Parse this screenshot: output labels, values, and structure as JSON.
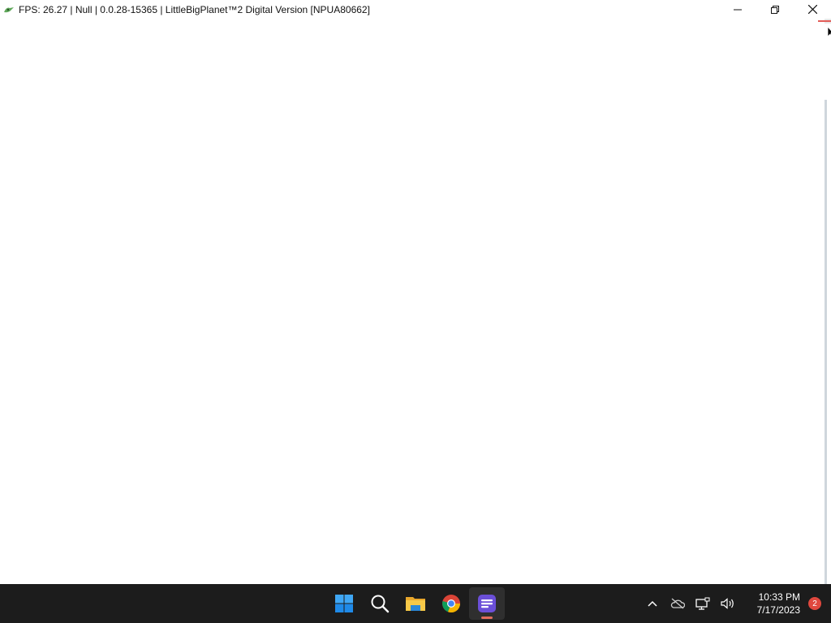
{
  "window": {
    "title": "FPS: 26.27 | Null | 0.0.28-15365 | LittleBigPlanet™2 Digital Version [NPUA80662]",
    "icon": "rpcs3-app-icon",
    "controls": [
      "minimize-icon",
      "restore-icon",
      "close-icon"
    ]
  },
  "taskbar": {
    "pinned": [
      {
        "name": "start",
        "icon": "windows-start-icon"
      },
      {
        "name": "search",
        "icon": "search-icon"
      },
      {
        "name": "file-explorer",
        "icon": "folder-icon"
      },
      {
        "name": "chrome",
        "icon": "chrome-icon"
      },
      {
        "name": "app",
        "icon": "purple-app-icon",
        "active": true
      }
    ],
    "tray": {
      "icons": [
        "chevron-up-icon",
        "onedrive-offline-icon",
        "network-icon",
        "volume-icon"
      ],
      "time": "10:33 PM",
      "date": "7/17/2023",
      "notification_count": "2"
    }
  },
  "colors": {
    "taskbar_bg": "#1c1c1c",
    "active_indicator": "#e36c5d",
    "notification_badge": "#e0483e",
    "accent_purple": "#6b4fd8"
  }
}
